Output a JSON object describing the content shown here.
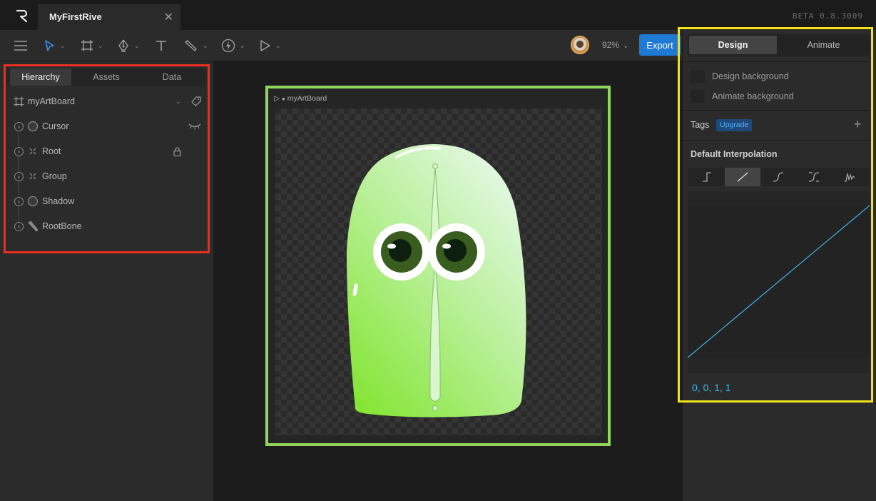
{
  "app": {
    "logo_text": "R",
    "document_tab": "MyFirstRive",
    "version": "BETA 0.8.3009"
  },
  "toolbar": {
    "tools": [
      "menu-icon",
      "select-icon",
      "artboard-icon",
      "pen-icon",
      "text-icon",
      "bone-icon",
      "lightning-icon",
      "play-icon"
    ],
    "zoom": "92%",
    "zoom_caret": "⌄",
    "export_label": "Export",
    "caret": "⌄"
  },
  "left_panel": {
    "tabs": [
      {
        "label": "Hierarchy",
        "active": true
      },
      {
        "label": "Assets",
        "active": false
      },
      {
        "label": "Data",
        "active": false
      }
    ],
    "artboard_item": "myArtBoard",
    "items": [
      {
        "label": "Cursor",
        "icon": "ellipse-icon",
        "trailing": "eye-closed-icon"
      },
      {
        "label": "Root",
        "icon": "group-icon",
        "trailing": "lock-icon"
      },
      {
        "label": "Group",
        "icon": "group-icon",
        "trailing": ""
      },
      {
        "label": "Shadow",
        "icon": "ellipse-icon",
        "trailing": ""
      },
      {
        "label": "RootBone",
        "icon": "bone-icon",
        "trailing": ""
      }
    ]
  },
  "canvas": {
    "artboard_label": "myArtBoard",
    "play_glyph": "▷",
    "dot_glyph": "●"
  },
  "right_panel": {
    "tabs": [
      {
        "label": "Design",
        "active": true
      },
      {
        "label": "Animate",
        "active": false
      }
    ],
    "design_background": "Design background",
    "animate_background": "Animate background",
    "tags_title": "Tags",
    "upgrade_badge": "Upgrade",
    "plus_glyph": "+",
    "interpolation_title": "Default Interpolation",
    "interpolation_modes": [
      "hold-icon",
      "linear-icon",
      "cubic-icon",
      "ease-icon",
      "elastic-icon"
    ],
    "active_mode": "linear-icon",
    "curve_values": "0, 0, 1, 1"
  },
  "colors": {
    "accent_blue": "#1f7ad6",
    "highlight_red": "#e8301e",
    "highlight_yellow": "#f2e21b",
    "highlight_green": "#8fd65a",
    "curve_color": "#3fb5e6"
  }
}
